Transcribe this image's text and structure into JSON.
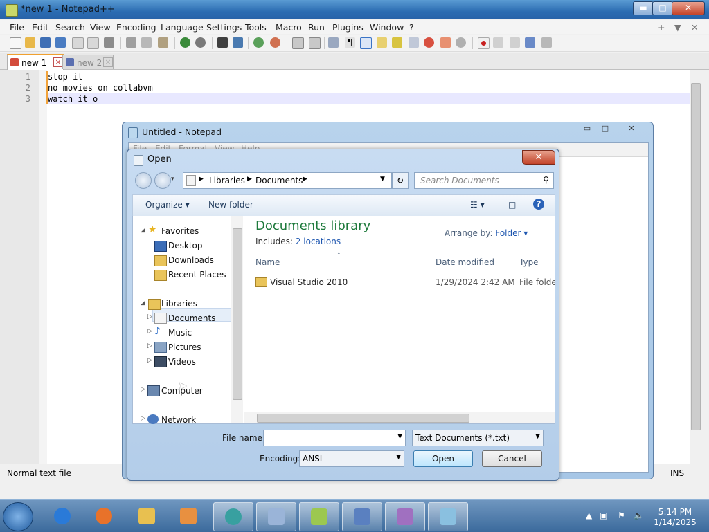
{
  "npp": {
    "title": "*new 1 - Notepad++",
    "menu": [
      "File",
      "Edit",
      "Search",
      "View",
      "Encoding",
      "Language",
      "Settings",
      "Tools",
      "Macro",
      "Run",
      "Plugins",
      "Window",
      "?"
    ],
    "menu_right": [
      "+",
      "▼",
      "✕"
    ],
    "tabs": [
      {
        "label": "new 1"
      },
      {
        "label": "new 2"
      }
    ],
    "lines": [
      "stop it",
      "no movies on collabvm",
      "watch it o"
    ],
    "line_numbers": [
      "1",
      "2",
      "3"
    ],
    "status_left": "Normal text file",
    "status_right": "INS",
    "caption_buttons": {
      "min": "▬",
      "max": "□",
      "close": "✕"
    }
  },
  "notepad": {
    "title": "Untitled - Notepad",
    "menu": [
      "File",
      "Edit",
      "Format",
      "View",
      "Help"
    ]
  },
  "dialog": {
    "title": "Open",
    "close": "✕",
    "breadcrumb": [
      "Libraries",
      "Documents"
    ],
    "search_placeholder": "Search Documents",
    "organize": "Organize ▾",
    "new_folder": "New folder",
    "nav": {
      "favorites": "Favorites",
      "desktop": "Desktop",
      "downloads": "Downloads",
      "recent": "Recent Places",
      "libraries": "Libraries",
      "documents": "Documents",
      "music": "Music",
      "pictures": "Pictures",
      "videos": "Videos",
      "computer": "Computer",
      "network": "Network"
    },
    "library_title": "Documents library",
    "includes_label": "Includes:",
    "includes_link": "2 locations",
    "arrange_label": "Arrange by:",
    "arrange_value": "Folder ▾",
    "columns": {
      "name": "Name",
      "date": "Date modified",
      "type": "Type"
    },
    "rows": [
      {
        "name": "Visual Studio 2010",
        "date": "1/29/2024 2:42 AM",
        "type": "File folder"
      }
    ],
    "file_name_label": "File name:",
    "file_name_value": "",
    "filter_value": "Text Documents (*.txt)",
    "encoding_label": "Encoding:",
    "encoding_value": "ANSI",
    "open_button": "Open",
    "cancel_button": "Cancel"
  },
  "taskbar": {
    "time": "5:14 PM",
    "date": "1/14/2025",
    "apps": [
      "internet-explorer",
      "firefox",
      "file-explorer",
      "media-player",
      "collabvm",
      "control-panel",
      "notepadpp",
      "network-app",
      "winrar",
      "notepad"
    ]
  }
}
